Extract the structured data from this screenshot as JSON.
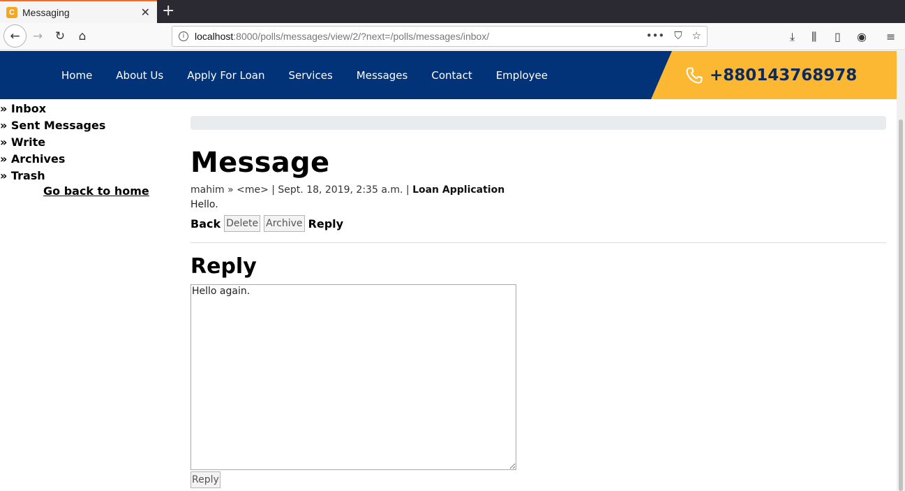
{
  "browser": {
    "tab_icon_letter": "C",
    "tab_title": "Messaging",
    "url_host": "localhost",
    "url_rest": ":8000/polls/messages/view/2/?next=/polls/messages/inbox/"
  },
  "header": {
    "menu": [
      "Home",
      "About Us",
      "Apply For Loan",
      "Services",
      "Messages",
      "Contact",
      "Employee"
    ],
    "phone": "+880143768978",
    "colors": {
      "nav_bg": "#023278",
      "phone_bg": "#fcb833"
    }
  },
  "sidebar": {
    "items": [
      "» Inbox",
      "» Sent Messages",
      "» Write",
      "» Archives",
      "» Trash"
    ],
    "home_link": "Go back to home"
  },
  "message": {
    "title": "Message",
    "meta_prefix": "mahim » <me> | Sept. 18, 2019, 2:35 a.m. |",
    "subject": "Loan Application",
    "body": "Hello.",
    "actions": {
      "back": "Back",
      "delete": "Delete",
      "archive": "Archive",
      "reply": "Reply"
    }
  },
  "reply": {
    "title": "Reply",
    "text": "Hello again.",
    "submit": "Reply"
  }
}
